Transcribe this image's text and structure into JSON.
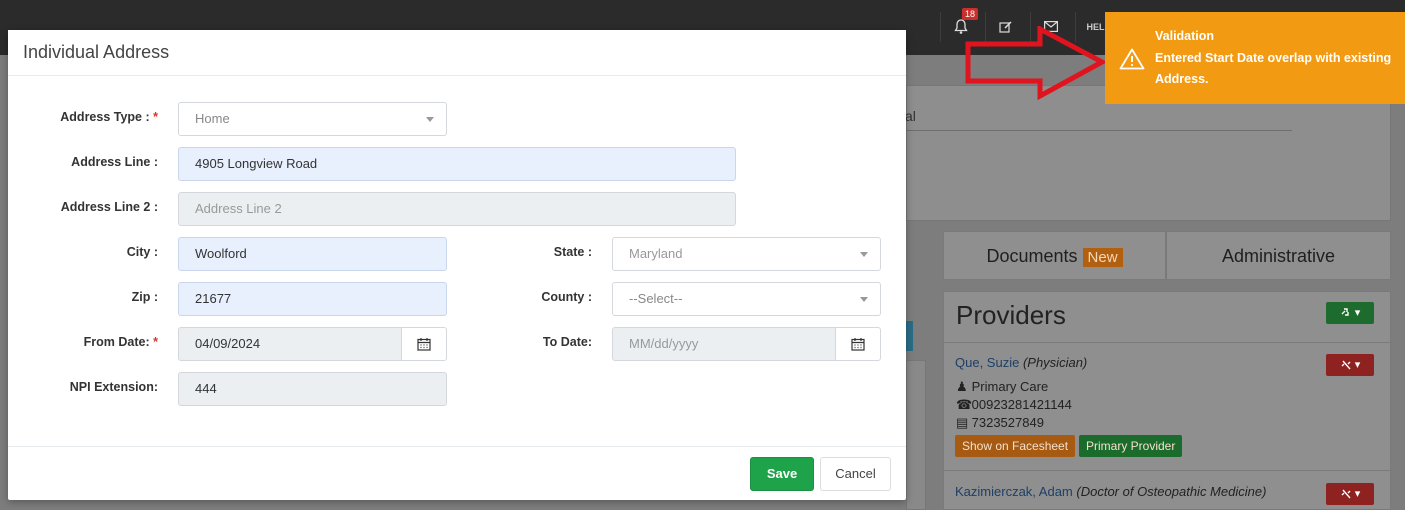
{
  "topbar": {
    "notification_count": "18",
    "help_label": "HEL"
  },
  "background": {
    "partial_text_al": "al",
    "tabs": [
      {
        "label": "Documents",
        "tag": "New"
      },
      {
        "label": "Administrative"
      }
    ],
    "providers": {
      "title": "Providers",
      "items": [
        {
          "name": "Que, Suzie",
          "role": "(Physician)",
          "specialty": "Primary Care",
          "phone": "00923281421144",
          "fax": "7323527849",
          "tags": [
            "Show on Facesheet",
            "Primary Provider"
          ]
        },
        {
          "name": "Kazimierczak, Adam",
          "role": "(Doctor of Osteopathic Medicine)"
        }
      ]
    }
  },
  "modal": {
    "title": "Individual Address",
    "fields": {
      "address_type": {
        "label": "Address Type :",
        "value": "Home"
      },
      "address_line": {
        "label": "Address Line :",
        "value": "4905 Longview Road"
      },
      "address_line2": {
        "label": "Address Line 2 :",
        "placeholder": "Address Line 2"
      },
      "city": {
        "label": "City :",
        "value": "Woolford"
      },
      "state": {
        "label": "State :",
        "value": "Maryland"
      },
      "zip": {
        "label": "Zip :",
        "value": "21677"
      },
      "county": {
        "label": "County :",
        "value": "--Select--"
      },
      "from_date": {
        "label": "From Date:",
        "value": "04/09/2024"
      },
      "to_date": {
        "label": "To Date:",
        "placeholder": "MM/dd/yyyy"
      },
      "npi_extension": {
        "label": "NPI Extension:",
        "value": "444"
      }
    },
    "required_marker": "*",
    "buttons": {
      "save": "Save",
      "cancel": "Cancel"
    }
  },
  "toast": {
    "title": "Validation",
    "message": "Entered Start Date overlap with existing Address.",
    "color": "#f39a13"
  },
  "colors": {
    "save_button": "#1ea24a",
    "arrow": "#e0141e"
  }
}
